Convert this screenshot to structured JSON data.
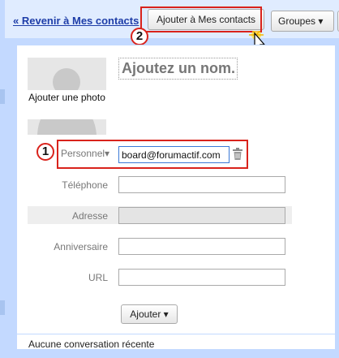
{
  "toolbar": {
    "back_link": "« Revenir à Mes contacts",
    "add_to_contacts": "Ajouter à Mes contacts",
    "groups": "Groupes ▾"
  },
  "callouts": {
    "first": "1",
    "second": "2"
  },
  "photo": {
    "label": "Ajouter une photo"
  },
  "name": {
    "placeholder": "Ajoutez un nom."
  },
  "email": {
    "type_label": "Personnel▾",
    "value": "board@forumactif.com"
  },
  "fields": {
    "phone_label": "Téléphone",
    "address_label": "Adresse",
    "birthday_label": "Anniversaire",
    "url_label": "URL"
  },
  "add_button": "Ajouter ▾",
  "footer": {
    "recent": "Aucune conversation récente"
  },
  "colors": {
    "highlight": "#d9231c",
    "link": "#1e3da8",
    "panel": "#e0ecff"
  },
  "icons": {
    "cursor": "cursor-click-icon",
    "trash": "trash-icon"
  }
}
